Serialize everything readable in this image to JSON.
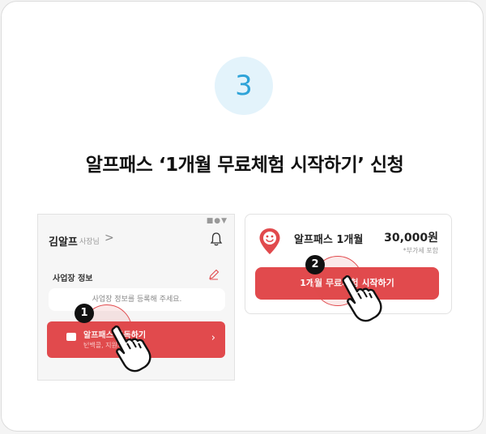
{
  "step": {
    "number": "3"
  },
  "headline": "알프패스 ‘1개월 무료체험 시작하기’ 신청",
  "phone": {
    "status_icons": "■●▼",
    "user_name": "김알프",
    "user_role": "사장님",
    "chevron": ">",
    "business_info_label": "사업장 정보",
    "business_info_placeholder": "사업장 정보를 등록해 주세요.",
    "pass_button": {
      "title": "알프패스 구독하기",
      "subtitle": "번백콜, 지원서 열람",
      "arrow": "›"
    }
  },
  "offer": {
    "plan_name": "알프패스 1개월",
    "price": "30,000원",
    "vat_note": "*부가세 포함",
    "cta_label": "1개월 무료체험 시작하기"
  },
  "markers": [
    {
      "label": "1"
    },
    {
      "label": "2"
    }
  ],
  "colors": {
    "accent": "#e14a4d",
    "step_bg": "#e3f3fb",
    "step_fg": "#2ea3d8"
  }
}
